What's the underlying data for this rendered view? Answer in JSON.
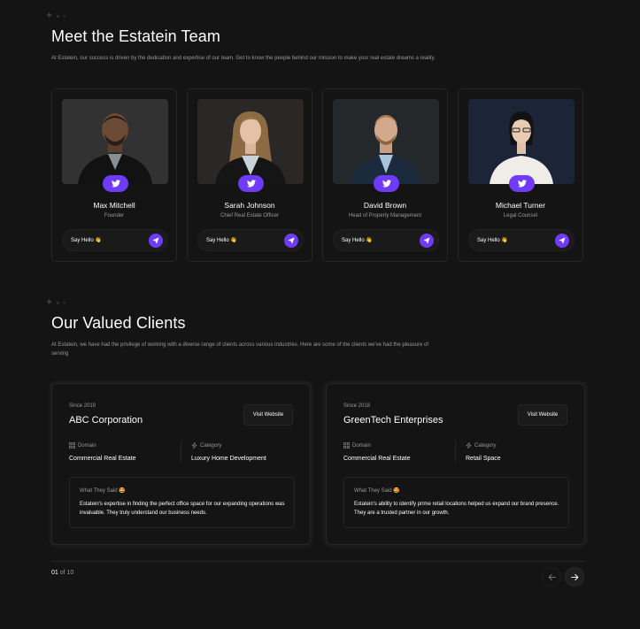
{
  "team": {
    "title": "Meet the Estatein Team",
    "description": "At Estatein, our success is driven by the dedication and expertise of our team. Get to know the people behind our mission to make your real estate dreams a reality.",
    "members": [
      {
        "name": "Max Mitchell",
        "role": "Founder",
        "say_hello": "Say Hello 👋"
      },
      {
        "name": "Sarah Johnson",
        "role": "Chief Real Estate Officer",
        "say_hello": "Say Hello 👋"
      },
      {
        "name": "David Brown",
        "role": "Head of Property Management",
        "say_hello": "Say Hello 👋"
      },
      {
        "name": "Michael Turner",
        "role": "Legal Counsel",
        "say_hello": "Say Hello 👋"
      }
    ]
  },
  "clients": {
    "title": "Our Valued Clients",
    "description_line1": "At Estatein, we have had the privilege of working with a diverse range of clients across various industries. Here are some of the clients we've had the pleasure of",
    "description_line2": "serving",
    "items": [
      {
        "since": "Since 2019",
        "name": "ABC Corporation",
        "visit_label": "Visit Website",
        "domain_label": "Domain",
        "domain": "Commercial Real Estate",
        "category_label": "Category",
        "category": "Luxury Home Development",
        "said_label": "What They Said 🤩",
        "testimonial": "Estatein's expertise in finding the perfect office space for our expanding operations was invaluable. They truly understand our business needs."
      },
      {
        "since": "Since 2018",
        "name": "GreenTech Enterprises",
        "visit_label": "Visit Website",
        "domain_label": "Domain",
        "domain": "Commercial Real Estate",
        "category_label": "Category",
        "category": "Retail Space",
        "said_label": "What They Said 🤩",
        "testimonial": "Estatein's ability to identify prime retail locations helped us expand our brand presence. They are a trusted partner in our growth."
      }
    ],
    "pager": {
      "current": "01",
      "of_text": " of 10"
    }
  },
  "colors": {
    "accent": "#703bf7",
    "background": "#141414",
    "border": "#262626",
    "muted": "#999999"
  },
  "icons": [
    "sparkle-icon",
    "twitter-icon",
    "send-icon",
    "grid-icon",
    "bolt-icon",
    "arrow-left-icon",
    "arrow-right-icon"
  ]
}
